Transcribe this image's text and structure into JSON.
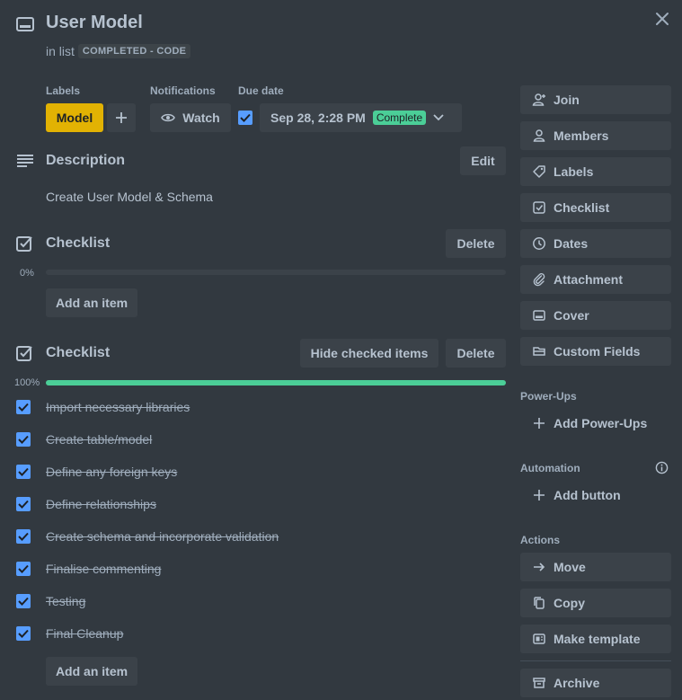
{
  "card": {
    "title": "User Model",
    "in_list_prefix": "in list",
    "list_name": "COMPLETED - CODE"
  },
  "labels": {
    "heading": "Labels",
    "chip": "Model",
    "chip_color": "#e2b203"
  },
  "notifications": {
    "heading": "Notifications",
    "watch_label": "Watch"
  },
  "due": {
    "heading": "Due date",
    "date": "Sep 28, 2:28 PM",
    "status": "Complete",
    "status_color": "#4bce97"
  },
  "description": {
    "heading": "Description",
    "edit_label": "Edit",
    "text": "Create User Model & Schema"
  },
  "checklist1": {
    "heading": "Checklist",
    "delete_label": "Delete",
    "progress_text": "0%",
    "progress": 0,
    "add_label": "Add an item"
  },
  "checklist2": {
    "heading": "Checklist",
    "hide_label": "Hide checked items",
    "delete_label": "Delete",
    "progress_text": "100%",
    "progress": 1.0,
    "progress_color": "#4bce97",
    "add_label": "Add an item",
    "items": [
      "Import necessary libraries",
      "Create table/model",
      "Define any foreign keys",
      "Define relationships",
      "Create schema and incorporate validation",
      "Finalise commenting",
      "Testing",
      "Final Cleanup"
    ]
  },
  "sidebar": {
    "add_to_card": [
      {
        "label": "Join",
        "icon": "person-add-icon"
      },
      {
        "label": "Members",
        "icon": "person-icon"
      },
      {
        "label": "Labels",
        "icon": "tag-icon"
      },
      {
        "label": "Checklist",
        "icon": "checklist-icon"
      },
      {
        "label": "Dates",
        "icon": "clock-icon"
      },
      {
        "label": "Attachment",
        "icon": "paperclip-icon"
      },
      {
        "label": "Cover",
        "icon": "cover-icon"
      },
      {
        "label": "Custom Fields",
        "icon": "custom-fields-icon"
      }
    ],
    "powerups": {
      "heading": "Power-Ups",
      "add_label": "Add Power-Ups"
    },
    "automation": {
      "heading": "Automation",
      "add_label": "Add button"
    },
    "actions": {
      "heading": "Actions",
      "items": [
        {
          "label": "Move",
          "icon": "arrow-right-icon"
        },
        {
          "label": "Copy",
          "icon": "copy-icon"
        },
        {
          "label": "Make template",
          "icon": "template-icon"
        },
        {
          "label": "Archive",
          "icon": "archive-icon"
        }
      ]
    }
  }
}
